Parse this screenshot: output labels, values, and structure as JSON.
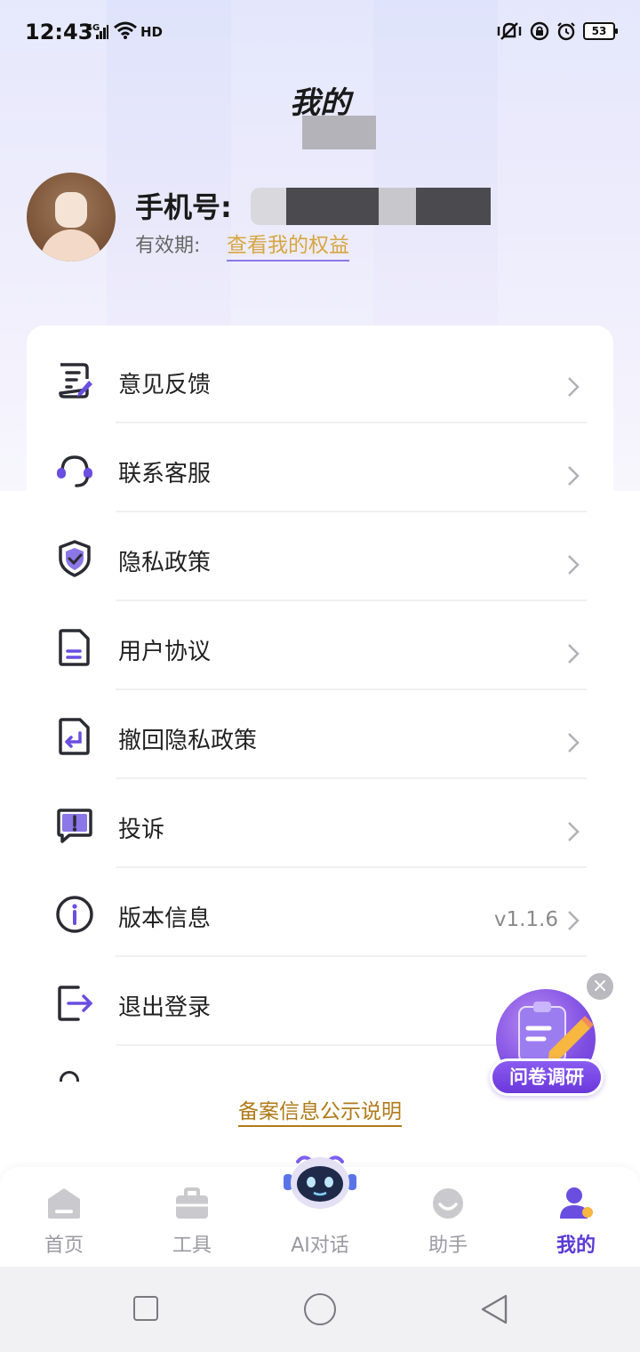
{
  "status_bar": {
    "time": "12:43",
    "network": "4G",
    "hd": "HD",
    "battery": "53"
  },
  "page_title": "我的",
  "profile": {
    "phone_label": "手机号:",
    "validity_label": "有效期:",
    "rights_link": "查看我的权益"
  },
  "menu": {
    "items": [
      {
        "label": "意见反馈",
        "icon": "feedback-icon"
      },
      {
        "label": "联系客服",
        "icon": "headset-icon"
      },
      {
        "label": "隐私政策",
        "icon": "shield-check-icon"
      },
      {
        "label": "用户协议",
        "icon": "document-icon"
      },
      {
        "label": "撤回隐私政策",
        "icon": "document-return-icon"
      },
      {
        "label": "投诉",
        "icon": "complaint-icon"
      },
      {
        "label": "版本信息",
        "icon": "info-icon",
        "value": "v1.1.6"
      },
      {
        "label": "退出登录",
        "icon": "logout-icon"
      }
    ]
  },
  "filing_link": "备案信息公示说明",
  "survey": {
    "label": "问卷调研",
    "close": "×"
  },
  "tabs": [
    {
      "label": "首页",
      "icon": "home-icon"
    },
    {
      "label": "工具",
      "icon": "toolbox-icon"
    },
    {
      "label": "AI对话",
      "icon": "robot-icon"
    },
    {
      "label": "助手",
      "icon": "assistant-icon"
    },
    {
      "label": "我的",
      "icon": "profile-icon",
      "active": true
    }
  ],
  "colors": {
    "accent": "#5a3ad6",
    "link_gold": "#d8a640",
    "icon_dark": "#2b2b33"
  }
}
